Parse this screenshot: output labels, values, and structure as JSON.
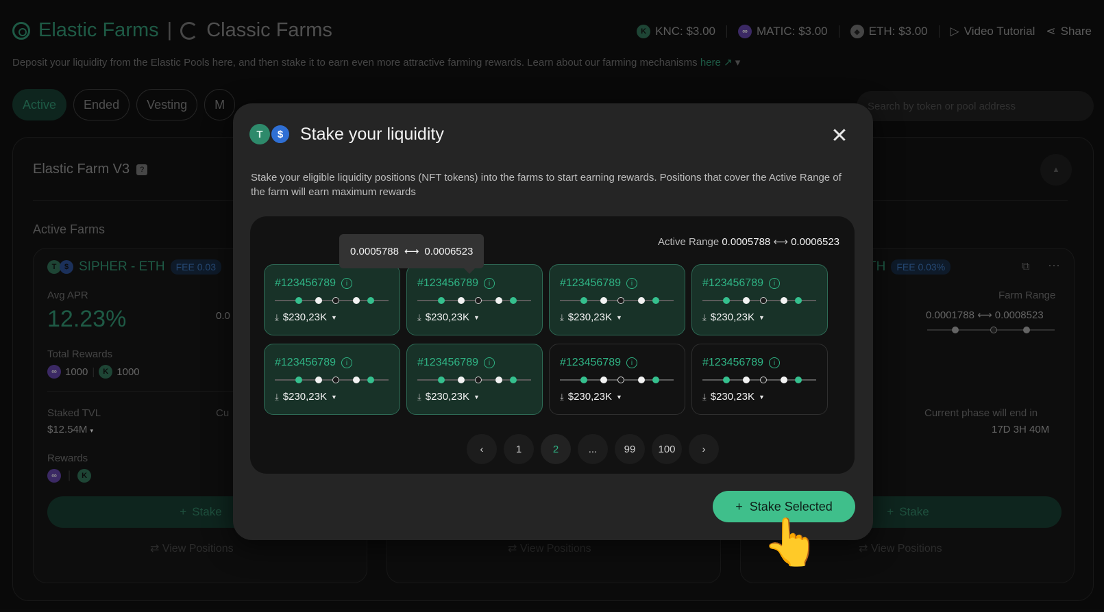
{
  "header": {
    "tab_elastic": "Elastic Farms",
    "separator": "|",
    "tab_classic": "Classic Farms",
    "prices": [
      {
        "label": "KNC: $3.00",
        "icon": "knc-coin-icon"
      },
      {
        "label": "MATIC: $3.00",
        "icon": "matic-coin-icon"
      },
      {
        "label": "ETH: $3.00",
        "icon": "eth-coin-icon"
      }
    ],
    "video_tutorial": "Video Tutorial",
    "share": "Share",
    "description": "Deposit your liquidity from the Elastic Pools here, and then stake it to earn even more attractive farming rewards. Learn about our farming mechanisms",
    "here_link": "here ↗",
    "accent": "#2e8a6b"
  },
  "filters": {
    "tabs": [
      "Active",
      "Ended",
      "Vesting",
      "M"
    ],
    "search_placeholder": "Search by token or pool address"
  },
  "farm_section": {
    "title": "Elastic Farm V3",
    "active_farms": "Active Farms",
    "left_card": {
      "pair": "SIPHER - ETH",
      "fee": "FEE 0.03",
      "avg_apr_label": "Avg APR",
      "avg_apr": "12.23%",
      "apr_partial": "0.0",
      "total_rewards_label": "Total Rewards",
      "reward_1": "1000",
      "reward_2": "1000",
      "staked_tvl_label": "Staked TVL",
      "staked_tvl": "$12.54M",
      "current_partial": "Cu",
      "rewards_label": "Rewards",
      "stake": "Stake",
      "view_positions": "View Positions"
    },
    "middle_card": {
      "view_positions": "View Positions"
    },
    "right_card": {
      "pair_partial": "TH",
      "fee": "FEE 0.03%",
      "farm_range_label": "Farm Range",
      "farm_range_low": "0.0001788",
      "farm_range_high": "0.0008523",
      "phase_label": "Current phase will end in",
      "phase_time": "17D 3H 40M",
      "stake": "Stake",
      "view_positions": "View Positions"
    }
  },
  "modal": {
    "title": "Stake your liquidity",
    "description": "Stake your eligible liquidity positions (NFT tokens) into the farms to start earning rewards. Positions that cover the Active Range of the farm will earn maximum rewards",
    "active_range_label": "Active Range",
    "active_range_low": "0.0005788",
    "active_range_high": "0.0006523",
    "tooltip_low": "0.0005788",
    "tooltip_high": "0.0006523",
    "positions": [
      {
        "id": "#123456789",
        "value": "$230,23K",
        "selected": true
      },
      {
        "id": "#123456789",
        "value": "$230,23K",
        "selected": true
      },
      {
        "id": "#123456789",
        "value": "$230,23K",
        "selected": true
      },
      {
        "id": "#123456789",
        "value": "$230,23K",
        "selected": true
      },
      {
        "id": "#123456789",
        "value": "$230,23K",
        "selected": true
      },
      {
        "id": "#123456789",
        "value": "$230,23K",
        "selected": true
      },
      {
        "id": "#123456789",
        "value": "$230,23K",
        "selected": false
      },
      {
        "id": "#123456789",
        "value": "$230,23K",
        "selected": false
      }
    ],
    "pagination": [
      "1",
      "2",
      "...",
      "99",
      "100"
    ],
    "current_page": "2",
    "stake_selected": "Stake Selected",
    "cta_color": "#3fbf8b"
  }
}
